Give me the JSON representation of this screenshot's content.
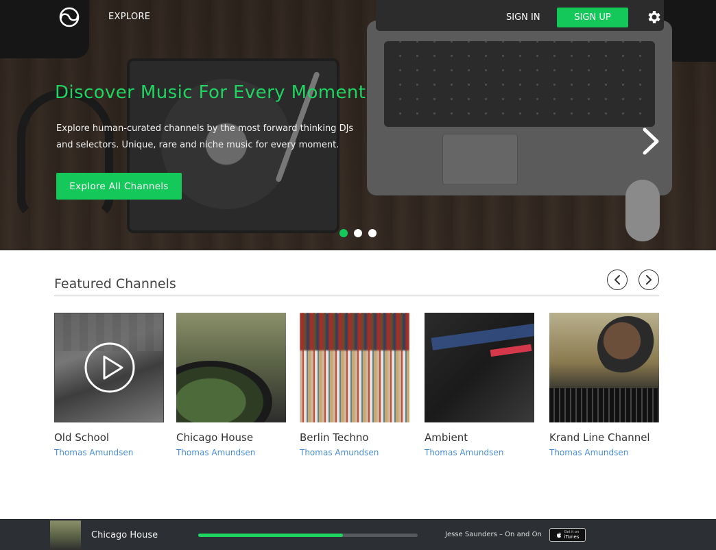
{
  "nav": {
    "explore_label": "EXPLORE",
    "signin_label": "SIGN IN",
    "signup_label": "SIGN UP"
  },
  "hero": {
    "title": "Discover Music For Every Moment",
    "description": "Explore human-curated channels by the most forward thinking DJs and selectors. Unique, rare and niche music for every moment.",
    "cta_label": "Explore All Channels",
    "slides": 3,
    "active_slide": 1
  },
  "featured": {
    "title": "Featured Channels",
    "channels": [
      {
        "title": "Old School",
        "author": "Thomas Amundsen"
      },
      {
        "title": "Chicago House",
        "author": "Thomas Amundsen"
      },
      {
        "title": "Berlin Techno",
        "author": "Thomas Amundsen"
      },
      {
        "title": "Ambient",
        "author": "Thomas Amundsen"
      },
      {
        "title": "Krand Line Channel",
        "author": "Thomas Amundsen"
      }
    ]
  },
  "player": {
    "channel": "Chicago House",
    "track": "Jesse Saunders – On and On",
    "progress": 0.66,
    "itunes_top": "Get it on",
    "itunes_label": "iTunes"
  },
  "colors": {
    "accent": "#15c85a",
    "hero_title": "#1fd461",
    "link": "#4a90d9",
    "player_bg": "#2c3035"
  },
  "icons": [
    "logo-icon",
    "gear-icon",
    "chevron-right-icon",
    "chevron-left-icon",
    "play-icon",
    "apple-icon"
  ]
}
